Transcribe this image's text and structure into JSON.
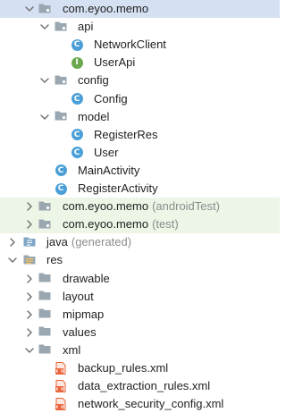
{
  "colors": {
    "selected_row_bg": "#d5e1f2",
    "test_row_bg": "#edf5e6",
    "folder": "#9aa7b0",
    "class_icon": "#4a9fd8",
    "interface_icon": "#6aa84f",
    "xml_icon": "#e9643b",
    "suffix_text": "#8c8c8c"
  },
  "icon_glyphs": {
    "class": "C",
    "interface": "I"
  },
  "tree": {
    "rows": [
      {
        "id": "com-eyoo-memo",
        "label": "com.eyoo.memo",
        "suffix": "",
        "icon": "package-folder-icon",
        "expanded": true,
        "selected": true
      },
      {
        "id": "api",
        "label": "api",
        "suffix": "",
        "icon": "package-folder-icon",
        "expanded": true
      },
      {
        "id": "networkclient",
        "label": "NetworkClient",
        "suffix": "",
        "icon": "class-icon"
      },
      {
        "id": "userapi",
        "label": "UserApi",
        "suffix": "",
        "icon": "interface-icon"
      },
      {
        "id": "config",
        "label": "config",
        "suffix": "",
        "icon": "package-folder-icon",
        "expanded": true
      },
      {
        "id": "config-class",
        "label": "Config",
        "suffix": "",
        "icon": "class-icon"
      },
      {
        "id": "model",
        "label": "model",
        "suffix": "",
        "icon": "package-folder-icon",
        "expanded": true
      },
      {
        "id": "registerres",
        "label": "RegisterRes",
        "suffix": "",
        "icon": "class-icon"
      },
      {
        "id": "user",
        "label": "User",
        "suffix": "",
        "icon": "class-icon"
      },
      {
        "id": "mainactivity",
        "label": "MainActivity",
        "suffix": "",
        "icon": "class-icon"
      },
      {
        "id": "registeractivity",
        "label": "RegisterActivity",
        "suffix": "",
        "icon": "class-icon"
      },
      {
        "id": "com-eyoo-memo-androidtest",
        "label": "com.eyoo.memo",
        "suffix": "(androidTest)",
        "icon": "package-folder-icon",
        "expanded": false
      },
      {
        "id": "com-eyoo-memo-test",
        "label": "com.eyoo.memo",
        "suffix": "(test)",
        "icon": "package-folder-icon",
        "expanded": false
      },
      {
        "id": "java-generated",
        "label": "java",
        "suffix": "(generated)",
        "icon": "generated-folder-icon",
        "expanded": false
      },
      {
        "id": "res",
        "label": "res",
        "suffix": "",
        "icon": "resource-folder-icon",
        "expanded": true
      },
      {
        "id": "drawable",
        "label": "drawable",
        "suffix": "",
        "icon": "folder-icon",
        "expanded": false
      },
      {
        "id": "layout",
        "label": "layout",
        "suffix": "",
        "icon": "folder-icon",
        "expanded": false
      },
      {
        "id": "mipmap",
        "label": "mipmap",
        "suffix": "",
        "icon": "folder-icon",
        "expanded": false
      },
      {
        "id": "values",
        "label": "values",
        "suffix": "",
        "icon": "folder-icon",
        "expanded": false
      },
      {
        "id": "xml",
        "label": "xml",
        "suffix": "",
        "icon": "folder-icon",
        "expanded": true
      },
      {
        "id": "backup-rules",
        "label": "backup_rules.xml",
        "suffix": "",
        "icon": "xml-file-icon"
      },
      {
        "id": "data-extraction-rules",
        "label": "data_extraction_rules.xml",
        "suffix": "",
        "icon": "xml-file-icon"
      },
      {
        "id": "network-security-config",
        "label": "network_security_config.xml",
        "suffix": "",
        "icon": "xml-file-icon"
      }
    ]
  }
}
